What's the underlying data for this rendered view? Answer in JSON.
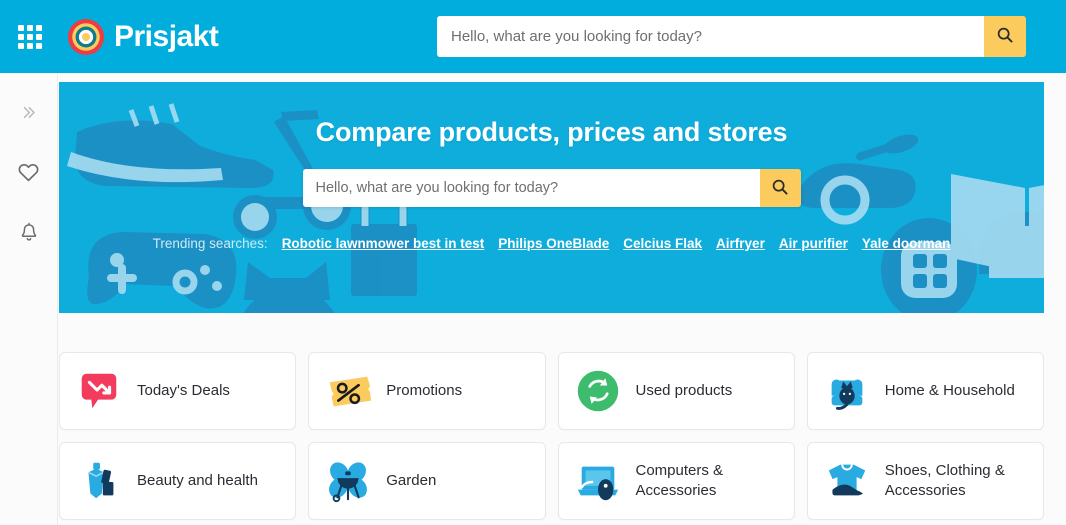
{
  "header": {
    "grid_menu_icon": "apps-grid-icon",
    "brand_name": "Prisjakt",
    "brand_logo_icon": "prisjakt-target-logo",
    "search": {
      "placeholder": "Hello, what are you looking for today?",
      "value": "",
      "button_icon": "search-icon"
    }
  },
  "sidebar": {
    "items": [
      {
        "icon": "double-chevron-right-icon",
        "name": "expand-sidebar"
      },
      {
        "icon": "heart-icon",
        "name": "favorites"
      },
      {
        "icon": "bell-icon",
        "name": "notifications"
      }
    ]
  },
  "hero": {
    "title": "Compare products, prices and stores",
    "search": {
      "placeholder": "Hello, what are you looking for today?",
      "value": "",
      "button_icon": "search-icon"
    },
    "trending_label": "Trending searches:",
    "trending": [
      "Robotic lawnmower best in test",
      "Philips OneBlade",
      "Celcius Flak",
      "Airfryer",
      "Air purifier",
      "Yale doorman"
    ]
  },
  "categories": [
    {
      "label": "Today's Deals",
      "icon": "price-drop-bubble-icon"
    },
    {
      "label": "Promotions",
      "icon": "percent-ticket-icon"
    },
    {
      "label": "Used products",
      "icon": "recycle-circle-icon"
    },
    {
      "label": "Home & Household",
      "icon": "armchair-cat-icon"
    },
    {
      "label": "Beauty and health",
      "icon": "cosmetics-icon"
    },
    {
      "label": "Garden",
      "icon": "grill-flower-icon"
    },
    {
      "label": "Computers & Accessories",
      "icon": "laptop-mouse-icon"
    },
    {
      "label": "Shoes, Clothing & Accessories",
      "icon": "tshirt-sneaker-icon"
    }
  ],
  "colors": {
    "header_blue": "#00ADDC",
    "hero_blue": "#0EADDC",
    "search_button_yellow": "#FBCB5E",
    "deals_pink": "#F23B5D",
    "promotions_yellow": "#FBCB5E",
    "used_green": "#3DBC6E",
    "category_blue": "#29ABE2",
    "dark_navy": "#123A5C"
  }
}
